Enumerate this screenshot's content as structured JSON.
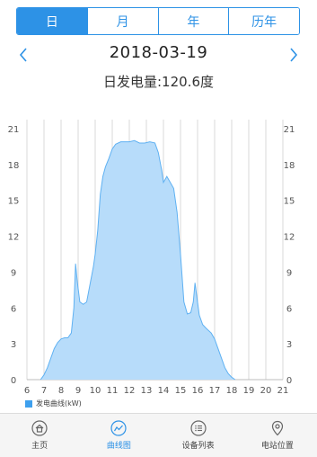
{
  "tabs": [
    {
      "label": "日",
      "active": true
    },
    {
      "label": "月",
      "active": false
    },
    {
      "label": "年",
      "active": false
    },
    {
      "label": "历年",
      "active": false
    }
  ],
  "date": "2018-03-19",
  "summary": "日发电量:120.6度",
  "colors": {
    "accent": "#2d92e6",
    "area_fill": "#b7dcfa",
    "area_line": "#5fb1f2",
    "legend": "#3ea0ee"
  },
  "chart_data": {
    "type": "area",
    "xlim": [
      6,
      21
    ],
    "ylim": [
      0,
      21
    ],
    "x_ticks": [
      "6",
      "7",
      "8",
      "9",
      "10",
      "11",
      "12",
      "13",
      "14",
      "15",
      "16",
      "17",
      "18",
      "19",
      "20",
      "21"
    ],
    "y_ticks_left": [
      "0",
      "3",
      "6",
      "9",
      "12",
      "15",
      "18",
      "21"
    ],
    "y_ticks_right": [
      "0",
      "3",
      "6",
      "9",
      "12",
      "15",
      "18",
      "21"
    ],
    "grid": "vertical",
    "series": [
      {
        "name": "发电曲线(kW)",
        "points": [
          [
            6.8,
            0
          ],
          [
            7.0,
            0.4
          ],
          [
            7.2,
            1.0
          ],
          [
            7.4,
            1.8
          ],
          [
            7.6,
            2.6
          ],
          [
            7.8,
            3.1
          ],
          [
            8.0,
            3.4
          ],
          [
            8.2,
            3.5
          ],
          [
            8.4,
            3.5
          ],
          [
            8.6,
            3.9
          ],
          [
            8.75,
            6.0
          ],
          [
            8.85,
            9.7
          ],
          [
            8.95,
            8.2
          ],
          [
            9.1,
            6.5
          ],
          [
            9.3,
            6.3
          ],
          [
            9.5,
            6.5
          ],
          [
            9.7,
            8.0
          ],
          [
            9.9,
            9.5
          ],
          [
            10.0,
            10.5
          ],
          [
            10.15,
            12.5
          ],
          [
            10.3,
            15.5
          ],
          [
            10.45,
            17.0
          ],
          [
            10.6,
            17.8
          ],
          [
            10.8,
            18.5
          ],
          [
            11.0,
            19.3
          ],
          [
            11.2,
            19.7
          ],
          [
            11.5,
            19.9
          ],
          [
            11.8,
            19.9
          ],
          [
            12.0,
            19.9
          ],
          [
            12.3,
            20.0
          ],
          [
            12.6,
            19.8
          ],
          [
            12.9,
            19.8
          ],
          [
            13.2,
            19.9
          ],
          [
            13.5,
            19.8
          ],
          [
            13.7,
            19.0
          ],
          [
            13.9,
            17.5
          ],
          [
            14.0,
            16.5
          ],
          [
            14.2,
            17.0
          ],
          [
            14.4,
            16.5
          ],
          [
            14.6,
            16.0
          ],
          [
            14.8,
            14.0
          ],
          [
            15.0,
            10.5
          ],
          [
            15.2,
            6.5
          ],
          [
            15.4,
            5.5
          ],
          [
            15.6,
            5.6
          ],
          [
            15.75,
            6.5
          ],
          [
            15.85,
            8.1
          ],
          [
            15.95,
            7.0
          ],
          [
            16.1,
            5.4
          ],
          [
            16.3,
            4.6
          ],
          [
            16.5,
            4.3
          ],
          [
            16.8,
            3.9
          ],
          [
            17.0,
            3.4
          ],
          [
            17.2,
            2.6
          ],
          [
            17.4,
            1.8
          ],
          [
            17.6,
            1.0
          ],
          [
            17.8,
            0.5
          ],
          [
            18.0,
            0.2
          ],
          [
            18.2,
            0
          ]
        ]
      }
    ]
  },
  "legend_label": "发电曲线(kW)",
  "bottom_nav": [
    {
      "label": "主页",
      "icon": "home-icon",
      "active": false
    },
    {
      "label": "曲线图",
      "icon": "chart-curve-icon",
      "active": true
    },
    {
      "label": "设备列表",
      "icon": "list-icon",
      "active": false
    },
    {
      "label": "电站位置",
      "icon": "location-pin-icon",
      "active": false
    }
  ]
}
